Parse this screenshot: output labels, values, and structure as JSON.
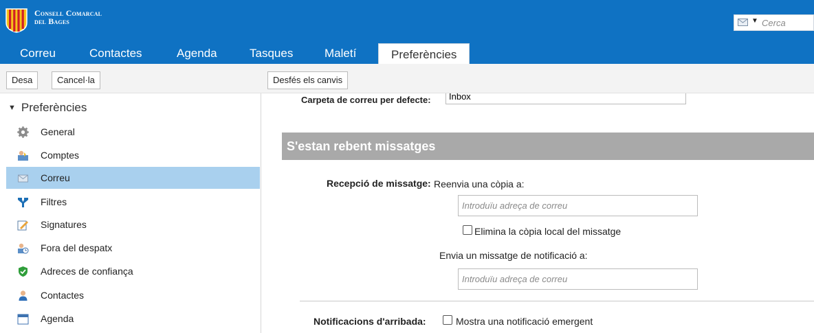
{
  "header": {
    "logo_line1": "Consell Comarcal",
    "logo_line2": "del Bages",
    "search_placeholder": "Cerca"
  },
  "tabs": [
    {
      "label": "Correu"
    },
    {
      "label": "Contactes"
    },
    {
      "label": "Agenda"
    },
    {
      "label": "Tasques"
    },
    {
      "label": "Maletí"
    },
    {
      "label": "Preferències",
      "active": true
    }
  ],
  "toolbar": {
    "save_label": "Desa",
    "cancel_label": "Cancel·la",
    "undo_label": "Desfés els canvis"
  },
  "sidebar": {
    "root_label": "Preferències",
    "items": [
      {
        "label": "General",
        "icon": "gear-icon"
      },
      {
        "label": "Comptes",
        "icon": "accounts-icon"
      },
      {
        "label": "Correu",
        "icon": "mail-icon",
        "selected": true
      },
      {
        "label": "Filtres",
        "icon": "filter-icon"
      },
      {
        "label": "Signatures",
        "icon": "signature-icon"
      },
      {
        "label": "Fora del despatx",
        "icon": "out-of-office-icon"
      },
      {
        "label": "Adreces de confiança",
        "icon": "trusted-shield-icon"
      },
      {
        "label": "Contactes",
        "icon": "contact-icon"
      },
      {
        "label": "Agenda",
        "icon": "calendar-icon"
      }
    ]
  },
  "main": {
    "default_folder_label": "Carpeta de correu per defecte:",
    "default_folder_value": "Inbox",
    "section_title": "S'estan rebent missatges",
    "receipt_label": "Recepció de missatge:",
    "forward_label": "Reenvia una còpia a:",
    "email_placeholder": "Introduïu adreça de correu",
    "delete_local_label": "Elimina la còpia local del missatge",
    "notify_label": "Envia un missatge de notificació a:",
    "arrival_label": "Notificacions d'arribada:",
    "popup_label": "Mostra una notificació emergent"
  },
  "colors": {
    "header_blue": "#0f72c3",
    "selected_item": "#a9d0ee",
    "section_gray": "#a9a9a9"
  }
}
